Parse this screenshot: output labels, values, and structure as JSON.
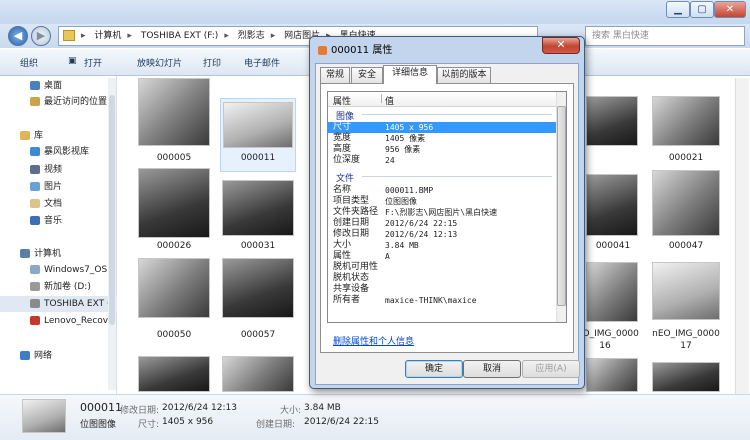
{
  "address": {
    "crumbs": [
      "计算机",
      "TOSHIBA EXT (F:)",
      "烈影志",
      "网店图片",
      "黑白快速"
    ],
    "search_placeholder": "搜索 黑白快速"
  },
  "toolbar": {
    "organize": "组织",
    "open": "打开",
    "slideshow": "放映幻灯片",
    "print": "打印",
    "email": "电子邮件"
  },
  "nav": {
    "favorites": [
      "桌面",
      "最近访问的位置"
    ],
    "libraries_header": "库",
    "libraries": [
      "暴风影视库",
      "视频",
      "图片",
      "文档",
      "音乐"
    ],
    "computer_header": "计算机",
    "drives": [
      "Windows7_OS (",
      "新加卷 (D:)",
      "TOSHIBA EXT (F",
      "Lenovo_Recove"
    ],
    "network_header": "网络"
  },
  "thumbnails": [
    {
      "label": "000005"
    },
    {
      "label": "000011"
    },
    {
      "label": "000021"
    },
    {
      "label": "000026"
    },
    {
      "label": "000031"
    },
    {
      "label": "000041"
    },
    {
      "label": "000047"
    },
    {
      "label": "000050"
    },
    {
      "label": "000057"
    },
    {
      "label": "nEO_IMG_0000\n16"
    },
    {
      "label": "nEO_IMG_0000\n17"
    }
  ],
  "details_pane": {
    "name": "000011",
    "type": "位图图像",
    "modified_label": "修改日期:",
    "modified": "2012/6/24 12:13",
    "dimensions_label": "尺寸:",
    "dimensions": "1405 x 956",
    "size_label": "大小:",
    "size": "3.84 MB",
    "created_label": "创建日期:",
    "created": "2012/6/24 22:15"
  },
  "dialog": {
    "title": "000011 属性",
    "tabs": [
      "常规",
      "安全",
      "详细信息",
      "以前的版本"
    ],
    "active_tab": 2,
    "columns": {
      "property": "属性",
      "value": "值"
    },
    "groups": {
      "image": "图像",
      "file": "文件"
    },
    "image_rows": [
      {
        "k": "尺寸",
        "v": "1405 x 956",
        "selected": true
      },
      {
        "k": "宽度",
        "v": "1405 像素"
      },
      {
        "k": "高度",
        "v": "956 像素"
      },
      {
        "k": "位深度",
        "v": "24"
      }
    ],
    "file_rows": [
      {
        "k": "名称",
        "v": "000011.BMP"
      },
      {
        "k": "项目类型",
        "v": "位图图像"
      },
      {
        "k": "文件夹路径",
        "v": "F:\\烈影志\\网店图片\\黑白快速"
      },
      {
        "k": "创建日期",
        "v": "2012/6/24 22:15"
      },
      {
        "k": "修改日期",
        "v": "2012/6/24 12:13"
      },
      {
        "k": "大小",
        "v": "3.84 MB"
      },
      {
        "k": "属性",
        "v": "A"
      },
      {
        "k": "脱机可用性",
        "v": ""
      },
      {
        "k": "脱机状态",
        "v": ""
      },
      {
        "k": "共享设备",
        "v": ""
      },
      {
        "k": "所有者",
        "v": "maxice-THINK\\maxice"
      }
    ],
    "remove_link": "删除属性和个人信息",
    "buttons": {
      "ok": "确定",
      "cancel": "取消",
      "apply": "应用(A)"
    }
  }
}
